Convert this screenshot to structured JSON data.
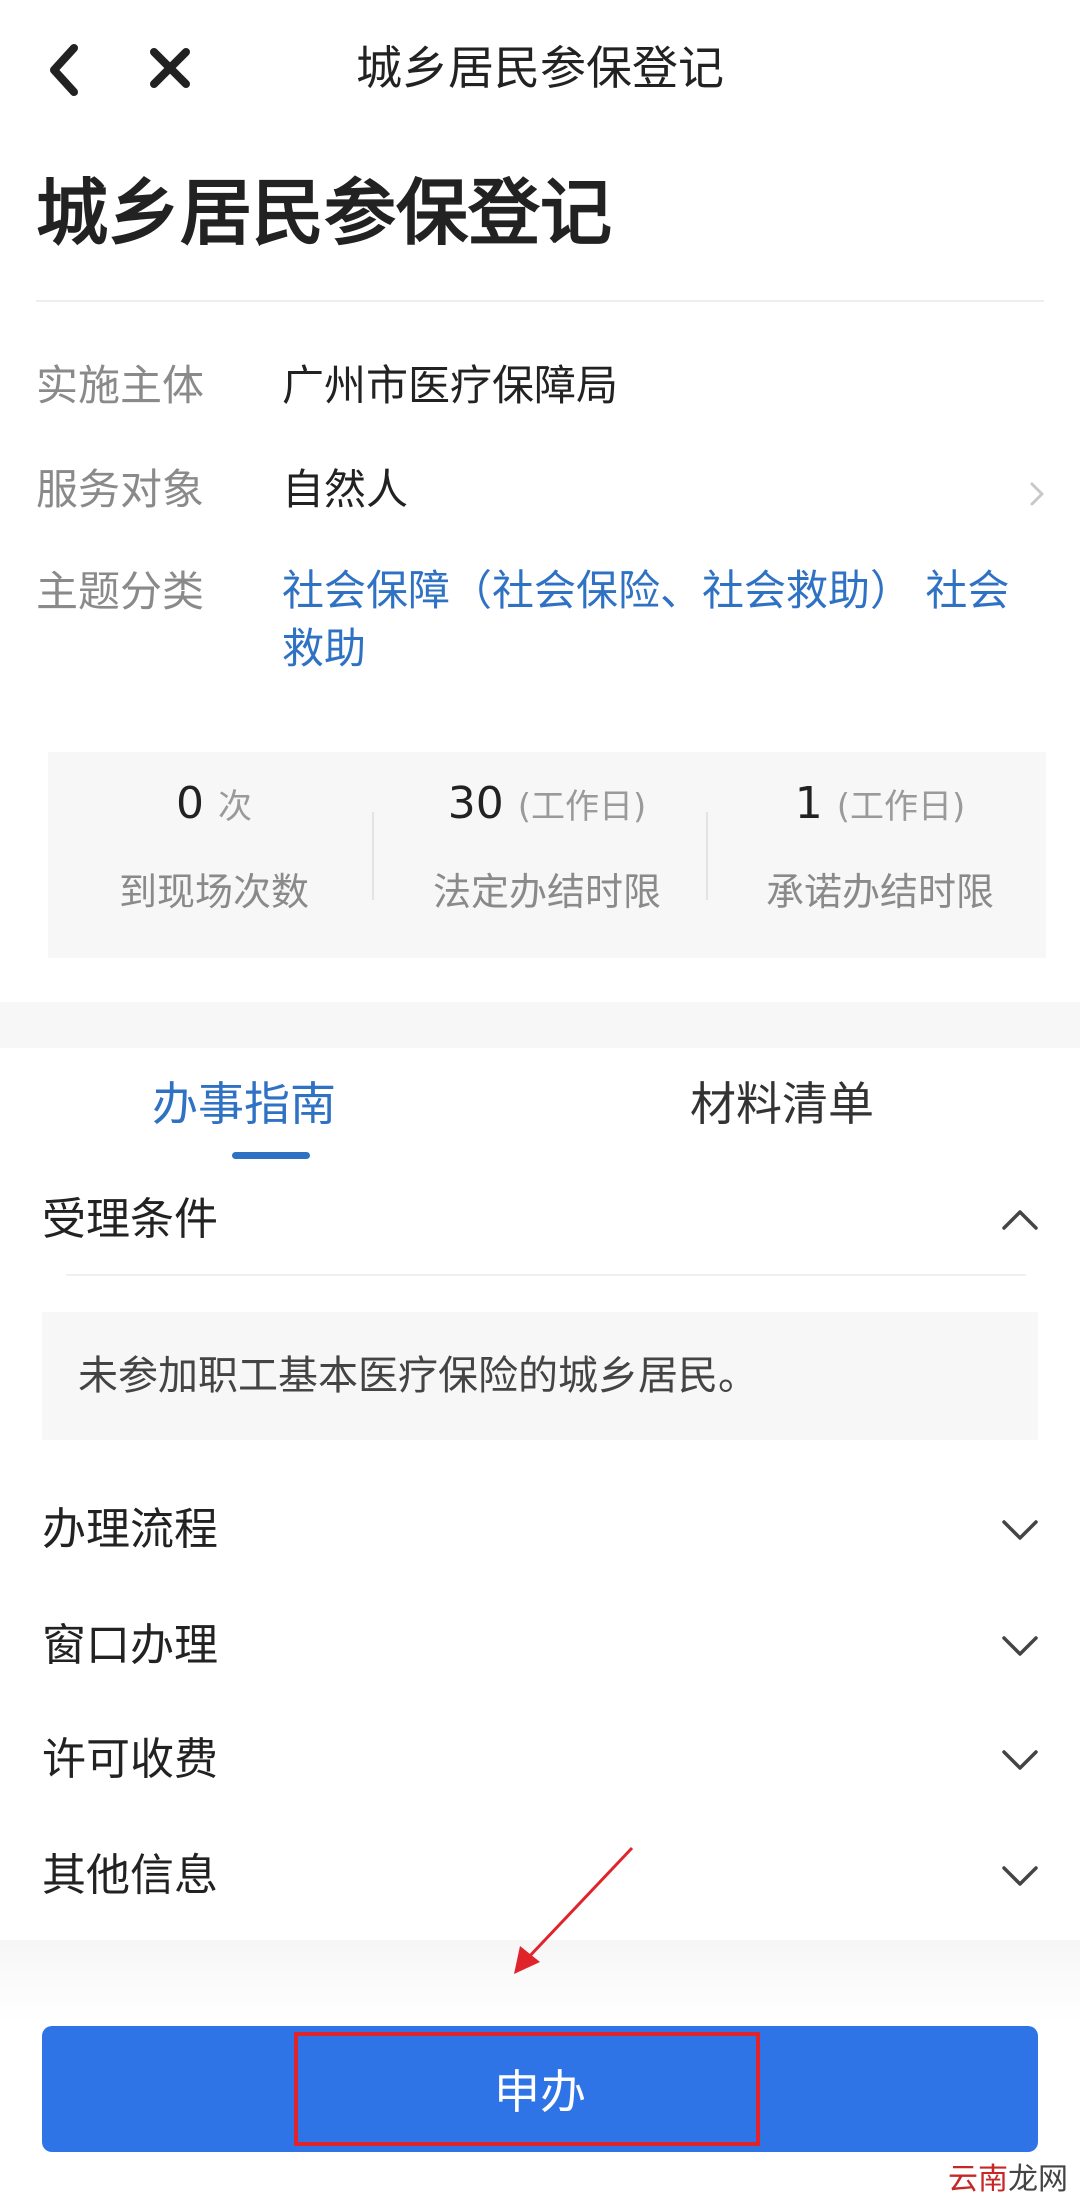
{
  "nav": {
    "title": "城乡居民参保登记",
    "back_icon": "chevron-left-icon",
    "close_icon": "close-icon"
  },
  "page": {
    "title": "城乡居民参保登记"
  },
  "info": {
    "agency_label": "实施主体",
    "agency_value": "广州市医疗保障局",
    "target_label": "服务对象",
    "target_value": "自然人",
    "topic_label": "主题分类",
    "topic_value": "社会保障（社会保险、社会救助） 社会救助"
  },
  "stats": [
    {
      "value": "0",
      "unit": "次",
      "label": "到现场次数"
    },
    {
      "value": "30",
      "unit": "(工作日)",
      "label": "法定办结时限"
    },
    {
      "value": "1",
      "unit": "(工作日)",
      "label": "承诺办结时限"
    }
  ],
  "tabs": [
    {
      "label": "办事指南",
      "active": true
    },
    {
      "label": "材料清单",
      "active": false
    }
  ],
  "sections": [
    {
      "title": "受理条件",
      "expanded": true,
      "content": "未参加职工基本医疗保险的城乡居民。"
    },
    {
      "title": "办理流程",
      "expanded": false
    },
    {
      "title": "窗口办理",
      "expanded": false
    },
    {
      "title": "许可收费",
      "expanded": false
    },
    {
      "title": "其他信息",
      "expanded": false
    }
  ],
  "apply_button": {
    "label": "申办"
  },
  "watermark": {
    "part1": "云南",
    "part2": "龙网"
  },
  "colors": {
    "accent": "#2f72c4",
    "button": "#2f74e6",
    "highlight": "#e0242b"
  }
}
